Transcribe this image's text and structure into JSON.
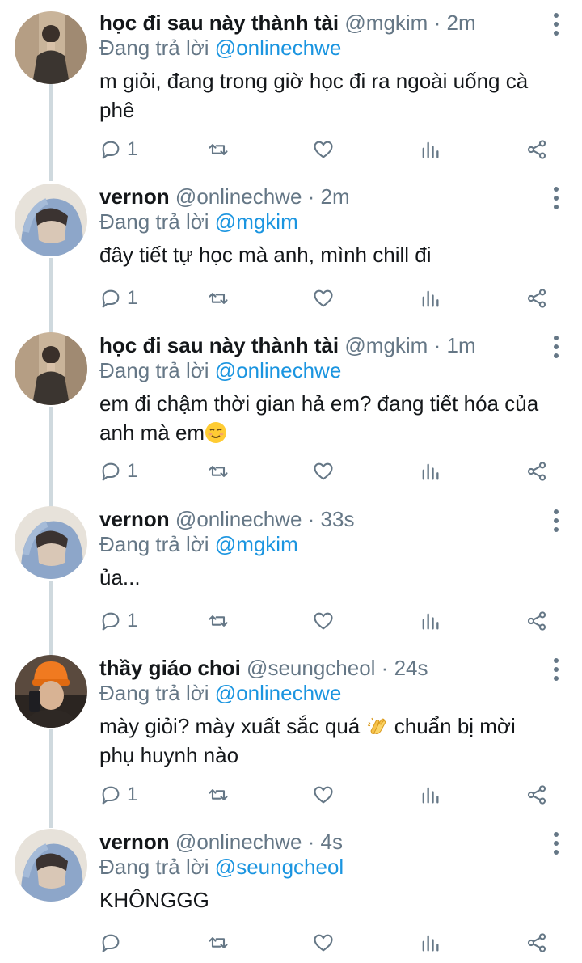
{
  "reply_prefix": "Đang trả lời",
  "separator": "·",
  "tweets": [
    {
      "name": "học đi sau này thành tài",
      "handle": "@mgkim",
      "time": "2m",
      "reply_to": "@onlinechwe",
      "text": "m giỏi, đang trong giờ học đi ra ngoài uống cà phê",
      "emoji": "",
      "reply_count": "1",
      "avatar": "mgkim-avatar"
    },
    {
      "name": "vernon",
      "handle": "@onlinechwe",
      "time": "2m",
      "reply_to": "@mgkim",
      "text": "đây tiết tự học mà anh, mình chill đi",
      "emoji": "",
      "reply_count": "1",
      "avatar": "vernon-avatar"
    },
    {
      "name": "học đi sau này thành tài",
      "handle": "@mgkim",
      "time": "1m",
      "reply_to": "@onlinechwe",
      "text": "em đi chậm thời gian hả em? đang tiết hóa của anh mà em",
      "emoji": "relieved-face-emoji",
      "reply_count": "1",
      "avatar": "mgkim-avatar"
    },
    {
      "name": "vernon",
      "handle": "@onlinechwe",
      "time": "33s",
      "reply_to": "@mgkim",
      "text": "ủa...",
      "emoji": "",
      "reply_count": "1",
      "avatar": "vernon-avatar"
    },
    {
      "name": "thầy giáo choi",
      "handle": "@seungcheol",
      "time": "24s",
      "reply_to": "@onlinechwe",
      "text_before": "mày giỏi? mày xuất sắc quá",
      "text_after": "chuẩn bị mời phụ huynh nào",
      "emoji": "clapping-hands-emoji",
      "reply_count": "1",
      "avatar": "seungcheol-avatar"
    },
    {
      "name": "vernon",
      "handle": "@onlinechwe",
      "time": "4s",
      "reply_to": "@seungcheol",
      "text": "KHÔNGGG",
      "emoji": "",
      "reply_count": "",
      "avatar": "vernon-avatar"
    }
  ],
  "colors": {
    "name": "#14171a",
    "meta": "#657786",
    "mention": "#1b95e0",
    "thread_line": "#cfd9de",
    "icon": "#657786"
  },
  "icons": [
    "reply-icon",
    "retweet-icon",
    "like-icon",
    "stats-icon",
    "share-icon",
    "more-options-icon"
  ]
}
